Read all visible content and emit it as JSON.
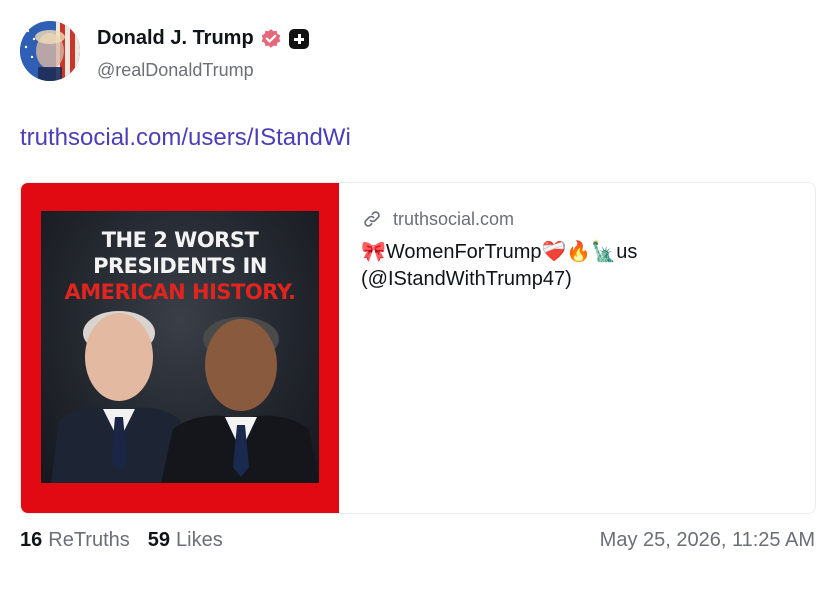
{
  "author": {
    "display_name": "Donald J. Trump",
    "handle": "@realDonaldTrump",
    "verified_icon": "verified-badge-icon",
    "plus_icon": "plus-badge-icon"
  },
  "post": {
    "link_text": "truthsocial.com/users/IStandWi"
  },
  "link_card": {
    "image_headline_line1": "THE 2 WORST",
    "image_headline_line2": "PRESIDENTS IN",
    "image_headline_line3": "AMERICAN HISTORY.",
    "domain": "truthsocial.com",
    "title": "🎀WomenForTrump❤️‍🩹🔥🗽us",
    "description": "(@IStandWithTrump47)"
  },
  "stats": {
    "retruths_count": "16",
    "retruths_label": "ReTruths",
    "likes_count": "59",
    "likes_label": "Likes"
  },
  "timestamp": "May 25, 2026, 11:25 AM",
  "colors": {
    "link": "#4a3fb8",
    "verified": "#e5697a",
    "card_frame": "#e10a12"
  }
}
